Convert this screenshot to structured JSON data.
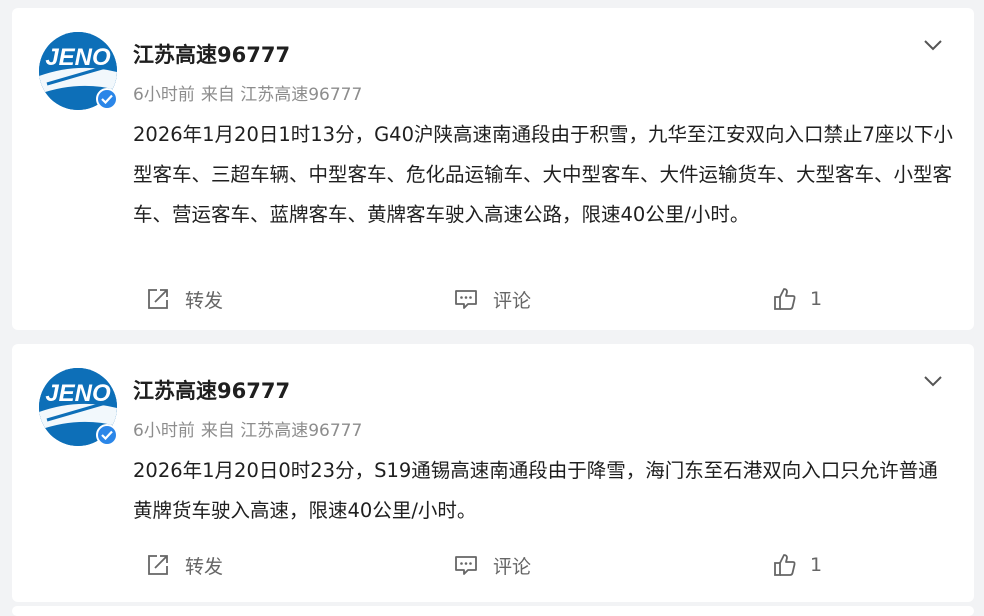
{
  "posts": [
    {
      "account_name": "江苏高速96777",
      "time": "6小时前",
      "source": "来自 江苏高速96777",
      "content": "2026年1月20日1时13分，G40沪陕高速南通段由于积雪，九华至江安双向入口禁止7座以下小型客车、三超车辆、中型客车、危化品运输车、大中型客车、大件运输货车、大型客车、小型客车、营运客车、蓝牌客车、黄牌客车驶入高速公路，限速40公里/小时。",
      "repost_label": "转发",
      "comment_label": "评论",
      "like_count": "1"
    },
    {
      "account_name": "江苏高速96777",
      "time": "6小时前",
      "source": "来自 江苏高速96777",
      "content": "2026年1月20日0时23分，S19通锡高速南通段由于降雪，海门东至石港双向入口只允许普通黄牌货车驶入高速，限速40公里/小时。",
      "repost_label": "转发",
      "comment_label": "评论",
      "like_count": "1"
    }
  ],
  "avatar_logo_text": "JENO",
  "icons": {
    "avatar_bg": "#0d6fb8",
    "verified_color": "#2b86e8",
    "action_color": "#666666"
  }
}
